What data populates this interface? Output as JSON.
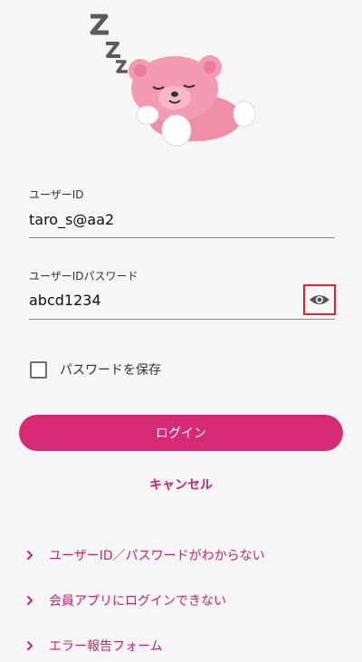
{
  "form": {
    "user_id_label": "ユーザーID",
    "user_id_value": "taro_s@aa2",
    "password_label": "ユーザーIDパスワード",
    "password_value": "abcd1234",
    "save_password_label": "パスワードを保存",
    "save_password_checked": false
  },
  "actions": {
    "login_label": "ログイン",
    "cancel_label": "キャンセル"
  },
  "links": [
    {
      "label": "ユーザーID／パスワードがわからない"
    },
    {
      "label": "会員アプリにログインできない"
    },
    {
      "label": "エラー報告フォーム"
    }
  ],
  "colors": {
    "accent": "#d62b74",
    "link": "#c8246c",
    "highlight_box": "#e0242b",
    "background": "#f6f6f6"
  },
  "icons": {
    "mascot": "sleeping-bear-icon",
    "password_visibility": "eye-icon",
    "link_chevron": "chevron-right-icon"
  }
}
